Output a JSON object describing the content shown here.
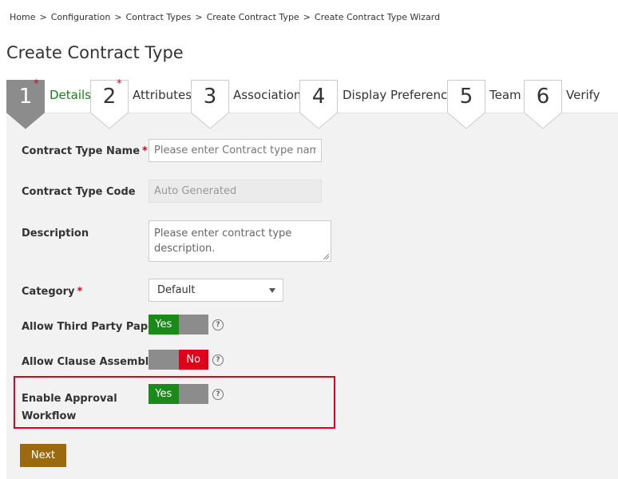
{
  "breadcrumb": {
    "items": [
      "Home",
      "Configuration",
      "Contract Types",
      "Create Contract Type",
      "Create Contract Type Wizard"
    ],
    "separator": ">"
  },
  "page": {
    "title": "Create Contract Type"
  },
  "wizard": {
    "steps": [
      {
        "number": "1",
        "label": "Details",
        "required": "*",
        "active": true
      },
      {
        "number": "2",
        "label": "Attributes",
        "required": "*",
        "active": false
      },
      {
        "number": "3",
        "label": "Association",
        "required": "",
        "active": false
      },
      {
        "number": "4",
        "label": "Display Preference",
        "required": "",
        "active": false
      },
      {
        "number": "5",
        "label": "Team",
        "required": "",
        "active": false
      },
      {
        "number": "6",
        "label": "Verify",
        "required": "",
        "active": false
      }
    ]
  },
  "form": {
    "contract_type_name": {
      "label": "Contract Type Name",
      "required": "*",
      "placeholder": "Please enter Contract type name."
    },
    "contract_type_code": {
      "label": "Contract Type Code",
      "value": "Auto Generated"
    },
    "description": {
      "label": "Description",
      "placeholder": "Please enter contract type description."
    },
    "category": {
      "label": "Category",
      "required": "*",
      "value": "Default"
    },
    "allow_third_party_paper": {
      "label": "Allow Third Party Paper",
      "state": "Yes"
    },
    "allow_clause_assembly": {
      "label": "Allow Clause Assembly",
      "state": "No"
    },
    "enable_approval_workflow": {
      "label_line1": "Enable Approval",
      "label_line2": "Workflow",
      "state": "Yes"
    },
    "help_glyph": "?"
  },
  "actions": {
    "next_label": "Next"
  },
  "colors": {
    "active_step": "#8c8c8c",
    "yes": "#1b8a1b",
    "no": "#e0001b",
    "next_button": "#9b6a0f",
    "highlight": "#e0001b"
  }
}
